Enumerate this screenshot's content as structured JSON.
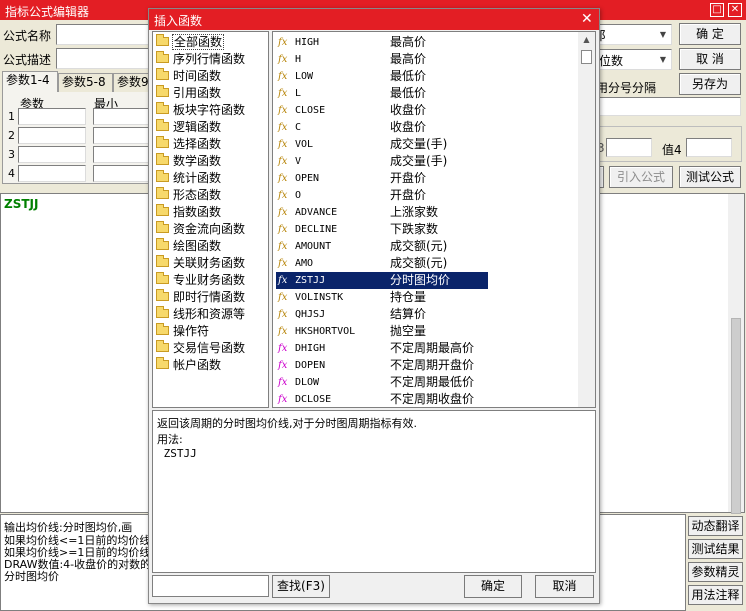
{
  "main_window": {
    "title": "指标公式编辑器",
    "formula_name_label": "公式名称",
    "formula_desc_label": "公式描述",
    "tabs": [
      "参数1-4",
      "参数5-8",
      "参数9"
    ],
    "param_header_name": "参数",
    "param_header_min": "最小",
    "param_rows": [
      "1",
      "2",
      "3",
      "4"
    ],
    "combo1_value": "阝",
    "combo2_value": "位数",
    "separator_label": "用分号分隔",
    "value3_label": "3",
    "value4_label": "值4",
    "btn_confirm": "确  定",
    "btn_cancel": "取  消",
    "btn_save_as": "另存为",
    "btn_import": "引入公式",
    "btn_test": "测试公式",
    "code_text": "ZSTJJ",
    "desc_lines": [
      "输出均价线:分时图均价,画",
      "如果均价线<=1日前的均价线",
      "如果均价线>=1日前的均价线",
      "DRAW数值:4-收盘价的对数的类",
      "分时图均价"
    ],
    "side_buttons": [
      "动态翻译",
      "测试结果",
      "参数精灵",
      "用法注释"
    ]
  },
  "dialog": {
    "title": "插入函数",
    "close_glyph": "✕",
    "categories": [
      "全部函数",
      "序列行情函数",
      "时间函数",
      "引用函数",
      "板块字符函数",
      "逻辑函数",
      "选择函数",
      "数学函数",
      "统计函数",
      "形态函数",
      "指数函数",
      "资金流向函数",
      "绘图函数",
      "关联财务函数",
      "专业财务函数",
      "即时行情函数",
      "线形和资源等",
      "操作符",
      "交易信号函数",
      "帐户函数"
    ],
    "selected_category": 0,
    "functions": [
      {
        "name": "HIGH",
        "desc": "最高价",
        "icon": "a"
      },
      {
        "name": "H",
        "desc": "最高价",
        "icon": "a"
      },
      {
        "name": "LOW",
        "desc": "最低价",
        "icon": "a"
      },
      {
        "name": "L",
        "desc": "最低价",
        "icon": "a"
      },
      {
        "name": "CLOSE",
        "desc": "收盘价",
        "icon": "a"
      },
      {
        "name": "C",
        "desc": "收盘价",
        "icon": "a"
      },
      {
        "name": "VOL",
        "desc": "成交量(手)",
        "icon": "a"
      },
      {
        "name": "V",
        "desc": "成交量(手)",
        "icon": "a"
      },
      {
        "name": "OPEN",
        "desc": "开盘价",
        "icon": "a"
      },
      {
        "name": "O",
        "desc": "开盘价",
        "icon": "a"
      },
      {
        "name": "ADVANCE",
        "desc": "上涨家数",
        "icon": "a"
      },
      {
        "name": "DECLINE",
        "desc": "下跌家数",
        "icon": "a"
      },
      {
        "name": "AMOUNT",
        "desc": "成交额(元)",
        "icon": "a"
      },
      {
        "name": "AMO",
        "desc": "成交额(元)",
        "icon": "a"
      },
      {
        "name": "ZSTJJ",
        "desc": "分时图均价",
        "icon": "a"
      },
      {
        "name": "VOLINSTK",
        "desc": "持仓量",
        "icon": "a"
      },
      {
        "name": "QHJSJ",
        "desc": "结算价",
        "icon": "a"
      },
      {
        "name": "HKSHORTVOL",
        "desc": "抛空量",
        "icon": "a"
      },
      {
        "name": "DHIGH",
        "desc": "不定周期最高价",
        "icon": "b"
      },
      {
        "name": "DOPEN",
        "desc": "不定周期开盘价",
        "icon": "b"
      },
      {
        "name": "DLOW",
        "desc": "不定周期最低价",
        "icon": "b"
      },
      {
        "name": "DCLOSE",
        "desc": "不定周期收盘价",
        "icon": "b"
      }
    ],
    "selected_function": 14,
    "fx_glyph": "fx",
    "help_lines": [
      "返回该周期的分时图均价线,对于分时图周期指标有效.",
      "用法:",
      " ZSTJJ"
    ],
    "search_value": "",
    "btn_find": "查找(F3)",
    "btn_ok": "确定",
    "btn_cancel": "取消"
  }
}
